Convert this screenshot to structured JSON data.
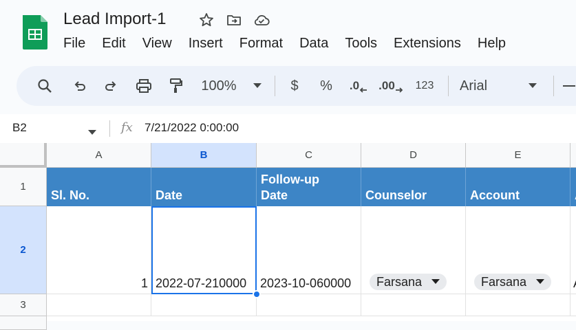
{
  "app": {
    "title": "Lead Import-1",
    "menu": [
      "File",
      "Edit",
      "View",
      "Insert",
      "Format",
      "Data",
      "Tools",
      "Extensions",
      "Help"
    ]
  },
  "toolbar": {
    "zoom": "100%",
    "currency": "$",
    "percent": "%",
    "decrease_decimals": ".0",
    "increase_decimals": ".00",
    "number_format": "123",
    "font": "Arial"
  },
  "formula_bar": {
    "cell_ref": "B2",
    "fx": "fx",
    "value": "7/21/2022 0:00:00"
  },
  "columns": [
    "A",
    "B",
    "C",
    "D",
    "E",
    ""
  ],
  "rows": [
    "1",
    "2",
    "3"
  ],
  "header_row": [
    "Sl. No.",
    "Date",
    "Follow-up\nDate",
    "Counselor",
    "Account",
    "A"
  ],
  "data_row": {
    "sl_no": "1",
    "date": "2022-07-210000",
    "follow_up_date": "2023-10-060000",
    "counselor": "Farsana",
    "account": "Farsana",
    "next": "A"
  },
  "colors": {
    "header_fill": "#3d85c6",
    "selection": "#1a73e8",
    "toolbar_bg": "#edf2fa",
    "logo_green": "#0f9d58"
  }
}
